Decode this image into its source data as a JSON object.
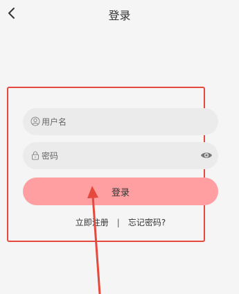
{
  "header": {
    "back_icon": "chevron-left-icon",
    "title": "登录"
  },
  "form": {
    "username": {
      "icon": "user-circle-icon",
      "placeholder": "用户名",
      "value": ""
    },
    "password": {
      "icon": "lock-icon",
      "placeholder": "密码",
      "value": "",
      "toggle_icon": "eye-icon"
    },
    "submit_label": "登录"
  },
  "links": {
    "register_label": "立即注册",
    "separator": "|",
    "forgot_label": "忘记密码?"
  },
  "colors": {
    "page_background": "#f5f5f5",
    "input_background": "#ebebeb",
    "submit_background": "#ff9fa1",
    "annotation_red": "#e5483c"
  }
}
